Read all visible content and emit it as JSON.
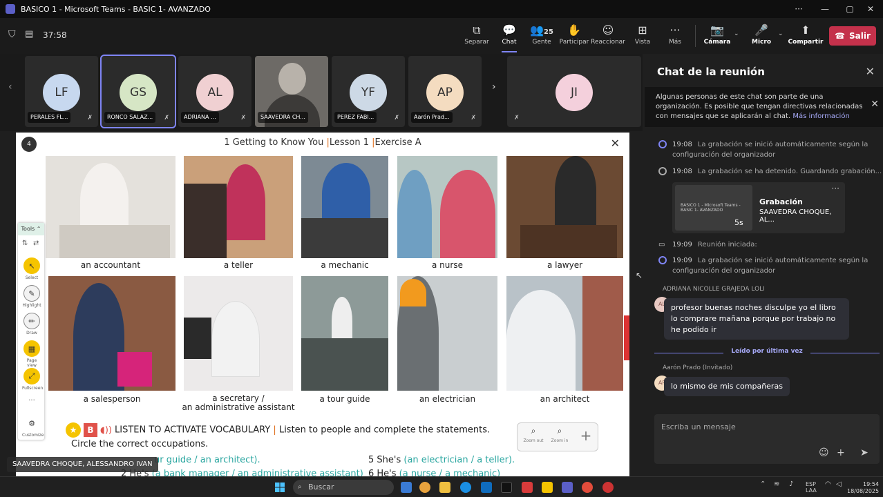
{
  "window": {
    "title": "BASICO 1 - Microsoft Teams - BASIC 1- AVANZADO",
    "minimize": "—",
    "maximize": "▢",
    "close": "✕",
    "more": "···"
  },
  "meeting": {
    "timer": "37:58",
    "toolbar": [
      {
        "label": "Separar",
        "icon": "⧉"
      },
      {
        "label": "Chat",
        "icon": "💬"
      },
      {
        "label": "Gente",
        "icon": "👥",
        "count": "25"
      },
      {
        "label": "Participar",
        "icon": "✋"
      },
      {
        "label": "Reaccionar",
        "icon": "☺"
      },
      {
        "label": "Vista",
        "icon": "⊞"
      },
      {
        "label": "Más",
        "icon": "···"
      },
      {
        "label": "Cámara",
        "icon": "📷"
      },
      {
        "label": "Micro",
        "icon": "🎤"
      },
      {
        "label": "Compartir",
        "icon": "⬆"
      }
    ],
    "leave_label": "Salir"
  },
  "participants": [
    {
      "initials": "LF",
      "name": "PERALES FL...",
      "color": "#c7d8ef"
    },
    {
      "initials": "GS",
      "name": "RONCO SALAZ...",
      "color": "#d6e6c5"
    },
    {
      "initials": "AL",
      "name": "ADRIANA ...",
      "color": "#f0d0d2"
    },
    {
      "initials": "",
      "name": "SAAVEDRA CH...",
      "color": "#8a8a8a"
    },
    {
      "initials": "YF",
      "name": "PEREZ FABI...",
      "color": "#cdd9e6"
    },
    {
      "initials": "AP",
      "name": "Aarón Prad...",
      "color": "#f4dcc0"
    },
    {
      "initials": "JI",
      "name": "",
      "color": "#f4d0dc"
    }
  ],
  "document": {
    "badge": "4",
    "title_parts": [
      "1 Getting to Know You ",
      "|",
      "Lesson 1 ",
      "|",
      "Exercise A"
    ],
    "close": "✕",
    "occupations": [
      "an accountant",
      "a teller",
      "a mechanic",
      "a nurse",
      "a lawyer",
      "a salesperson",
      "a secretary /",
      "a tour guide",
      "an electrician",
      "an architect"
    ],
    "secretary_line2": "an administrative assistant",
    "tools": {
      "header": "Tools ⌃",
      "items": [
        {
          "label": "Select",
          "icon": "↖"
        },
        {
          "label": "Highlight",
          "icon": "✎"
        },
        {
          "label": "Draw",
          "icon": "✏"
        },
        {
          "label": "Page view",
          "icon": "▦"
        },
        {
          "label": "Fullscreen",
          "icon": "⤢"
        },
        {
          "label": "Customize",
          "icon": "⚙"
        }
      ],
      "misc": "···"
    },
    "exercise_b": {
      "letter": "B",
      "heading": "LISTEN TO ACTIVATE VOCABULARY",
      "instruction": "Listen to people and complete the statements.",
      "line2": "Circle the correct occupations."
    },
    "zoom": {
      "out": "Zoom out",
      "in": "Zoom in",
      "plus": "+"
    },
    "statements": [
      {
        "text": "",
        "options": "ur guide / an architect)."
      },
      {
        "text": "2  He's ",
        "options": "(a bank manager / an administrative assistant)"
      },
      {
        "text": "5  She's ",
        "options": "(an electrician / a teller)."
      },
      {
        "text": "6  He's ",
        "options": "(a nurse / a mechanic)"
      }
    ]
  },
  "presenter_tag": "SAAVEDRA CHOQUE, ALESSANDRO IVAN",
  "chat": {
    "title": "Chat de la reunión",
    "banner": "Algunas personas de este chat son parte de una organización. Es posible que tengan directivas relacionadas con mensajes que se aplicarán al chat.",
    "banner_link": "Más información",
    "events": [
      {
        "time": "19:08",
        "text": "La grabación se inició automáticamente según la",
        "text2": "configuración del organizador"
      },
      {
        "time": "19:08",
        "text": "La grabación se ha detenido. Guardando grabación...",
        "text2": ""
      },
      {
        "time": "19:09",
        "text": "Reunión iniciada:",
        "text2": ""
      },
      {
        "time": "19:09",
        "text": "La grabación se inició automáticamente según la",
        "text2": "configuración del organizador"
      }
    ],
    "recording": {
      "thumb_text": "BASICO 1 - Microsoft Teams - BASIC 1- AVANZADO",
      "duration": "5s",
      "title": "Grabación",
      "subtitle": "SAAVEDRA CHOQUE, AL..."
    },
    "messages": [
      {
        "sender": "ADRIANA NICOLLE GRAJEDA LOLI",
        "initials": "AL",
        "text": "profesor buenas noches disculpe yo el libro lo comprare mañana porque por trabajo no he podido ir"
      },
      {
        "sender": "Aarón Prado (Invitado)",
        "initials": "AP",
        "text": "lo mismo de mis compañeras"
      }
    ],
    "read_marker": "Leído por última vez",
    "compose_placeholder": "Escriba un mensaje",
    "compose_icons": [
      "☺",
      "+",
      "➤"
    ]
  },
  "taskbar": {
    "search_label": "Buscar",
    "tray": {
      "lang": "ESP",
      "lang2": "LAA"
    },
    "clock": {
      "time": "19:54",
      "date": "18/08/2025"
    }
  }
}
